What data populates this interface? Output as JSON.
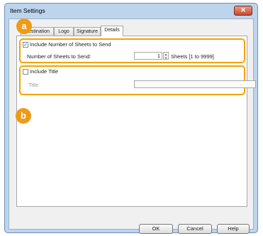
{
  "window": {
    "title": "Item Settings",
    "close_glyph": "✕"
  },
  "tabs": [
    {
      "label": "Destination"
    },
    {
      "label": "Logo"
    },
    {
      "label": "Signature"
    },
    {
      "label": "Details",
      "active": true
    }
  ],
  "callouts": {
    "a": "a",
    "b": "b",
    "color": "#ee9b18"
  },
  "sheets": {
    "checkbox_label": "Include Number of Sheets to Send",
    "checked": true,
    "check_glyph": "✓",
    "field_label": "Number of Sheets to Send:",
    "value": "1",
    "range_text": "Sheets [1 to 9999]"
  },
  "title_section": {
    "checkbox_label": "Include Title",
    "checked": false,
    "field_label": "Title:",
    "value": ""
  },
  "buttons": {
    "ok": "OK",
    "cancel": "Cancel",
    "help": "Help"
  }
}
